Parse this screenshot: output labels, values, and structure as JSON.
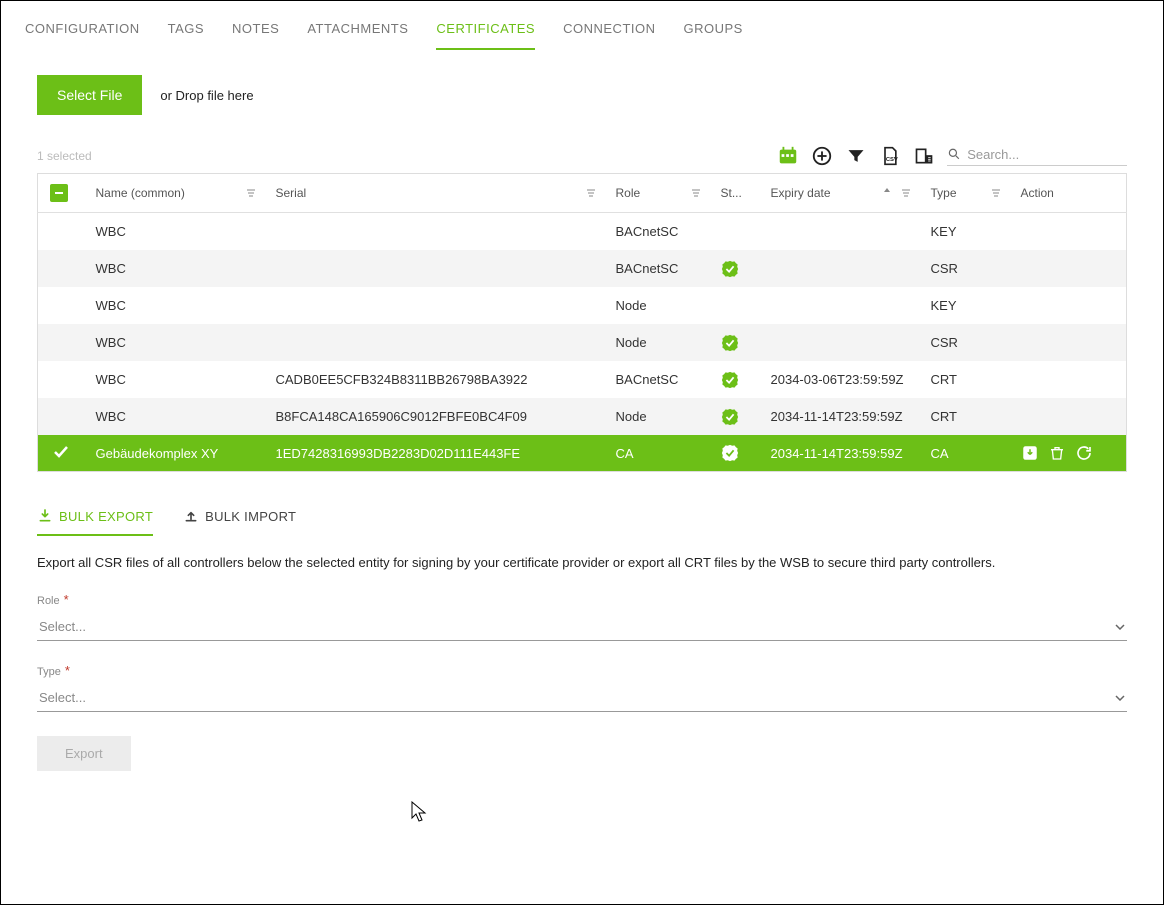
{
  "tabs": [
    "CONFIGURATION",
    "TAGS",
    "NOTES",
    "ATTACHMENTS",
    "CERTIFICATES",
    "CONNECTION",
    "GROUPS"
  ],
  "active_tab_index": 4,
  "upload": {
    "button": "Select File",
    "hint": "or Drop file here"
  },
  "selected_count": "1 selected",
  "search": {
    "placeholder": "Search..."
  },
  "columns": {
    "name": "Name (common)",
    "serial": "Serial",
    "role": "Role",
    "status": "St...",
    "expiry": "Expiry date",
    "type": "Type",
    "action": "Action"
  },
  "rows": [
    {
      "name": "WBC",
      "serial": "",
      "role": "BACnetSC",
      "status": false,
      "expiry": "",
      "type": "KEY",
      "selected": false
    },
    {
      "name": "WBC",
      "serial": "",
      "role": "BACnetSC",
      "status": true,
      "expiry": "",
      "type": "CSR",
      "selected": false
    },
    {
      "name": "WBC",
      "serial": "",
      "role": "Node",
      "status": false,
      "expiry": "",
      "type": "KEY",
      "selected": false
    },
    {
      "name": "WBC",
      "serial": "",
      "role": "Node",
      "status": true,
      "expiry": "",
      "type": "CSR",
      "selected": false
    },
    {
      "name": "WBC",
      "serial": "CADB0EE5CFB324B8311BB26798BA3922",
      "role": "BACnetSC",
      "status": true,
      "expiry": "2034-03-06T23:59:59Z",
      "type": "CRT",
      "selected": false
    },
    {
      "name": "WBC",
      "serial": "B8FCA148CA165906C9012FBFE0BC4F09",
      "role": "Node",
      "status": true,
      "expiry": "2034-11-14T23:59:59Z",
      "type": "CRT",
      "selected": false
    },
    {
      "name": "Gebäudekomplex XY",
      "serial": "1ED7428316993DB2283D02D111E443FE",
      "role": "CA",
      "status": true,
      "expiry": "2034-11-14T23:59:59Z",
      "type": "CA",
      "selected": true
    }
  ],
  "sub_tabs": {
    "export": "BULK EXPORT",
    "import": "BULK IMPORT"
  },
  "active_sub_tab": "export",
  "export_description": "Export all CSR files of all controllers below the selected entity for signing by your certificate provider or export all CRT files by the WSB to secure third party controllers.",
  "form": {
    "role_label": "Role",
    "type_label": "Type",
    "select_placeholder": "Select...",
    "export_button": "Export"
  },
  "colors": {
    "accent": "#6cbf17"
  }
}
